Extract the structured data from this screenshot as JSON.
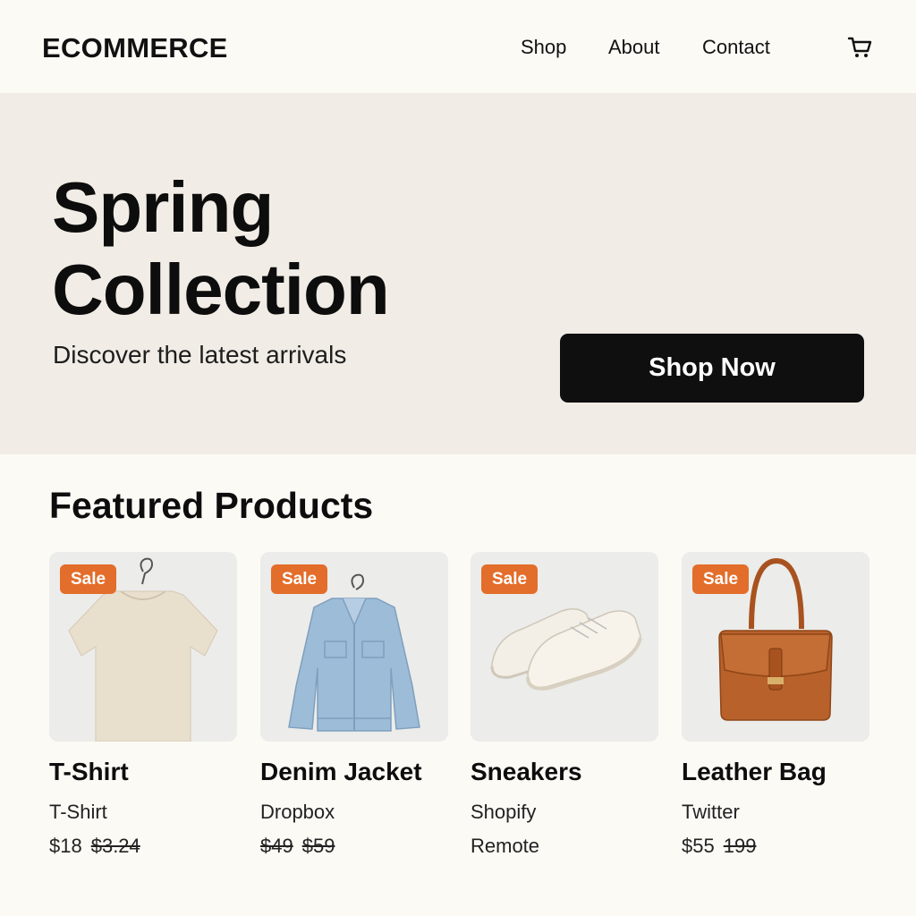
{
  "header": {
    "brand": "ECOMMERCE",
    "nav": [
      "Shop",
      "About",
      "Contact"
    ],
    "cart_icon": "shopping-cart-icon"
  },
  "hero": {
    "title_line1": "Spring",
    "title_line2": "Collection",
    "subtitle": "Discover the latest arrivals",
    "cta": "Shop Now"
  },
  "featured": {
    "title": "Featured Products",
    "products": [
      {
        "badge": "Sale",
        "name": "T-Shirt",
        "sub": "T-Shirt",
        "price": "$18",
        "old_price": "$3.24",
        "image": "t-shirt-image"
      },
      {
        "badge": "Sale",
        "name": "Denim Jacket",
        "sub": "Dropbox",
        "price": "$49",
        "old_price": "$59",
        "image": "denim-jacket-image"
      },
      {
        "badge": "Sale",
        "name": "Sneakers",
        "sub": "Shopify",
        "extra": "Remote",
        "image": "sneakers-image"
      },
      {
        "badge": "Sale",
        "name": "Leather Bag",
        "sub": "Twitter",
        "price": "$55",
        "old_price": "199",
        "image": "leather-bag-image"
      }
    ]
  },
  "colors": {
    "background": "#fcfaf5",
    "hero_bg": "#f1ece5",
    "button_bg": "#0f0f0f",
    "sale_badge": "#e36d2a"
  }
}
